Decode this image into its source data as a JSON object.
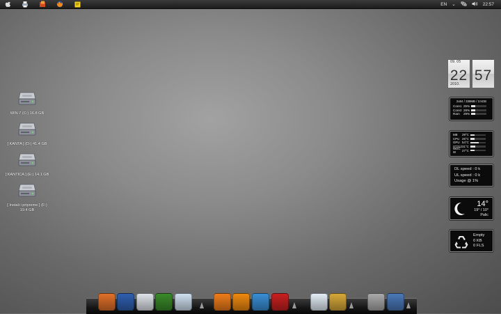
{
  "menubar": {
    "left_icons": [
      "apple-icon",
      "printer-icon",
      "office-icon",
      "firefox-icon",
      "sticky-note-icon"
    ],
    "lang": "EN",
    "time": "22:57"
  },
  "drives": [
    {
      "line1": "WIN 7 (C:) 16.8 GB",
      "line2": ""
    },
    {
      "line1": "[ KANTA ] (D:) 41.4 GB",
      "line2": ""
    },
    {
      "line1": "[ KANTICA ] (E:) 14.1 GB",
      "line2": ""
    },
    {
      "line1": "[ Instali i pripreme ] (F:)",
      "line2": "19.4 GB"
    }
  ],
  "clock": {
    "date": "09. 05",
    "year": "2010.",
    "hour": "22",
    "minute": "57"
  },
  "cpu_widget": {
    "header": "2x84 / 338MB / 3.5GB",
    "rows": [
      {
        "label": "Core1",
        "pct": "25%",
        "value": 0.25
      },
      {
        "label": "Core2",
        "pct": "28%",
        "value": 0.28
      },
      {
        "label": "Ram",
        "pct": "29%",
        "value": 0.29
      }
    ]
  },
  "temp_widget": {
    "rows": [
      {
        "label": "MB",
        "val": "29°C",
        "value": 0.29
      },
      {
        "label": "CPU",
        "val": "25°C",
        "value": 0.25
      },
      {
        "label": "GPU",
        "val": "54°C",
        "value": 0.54
      },
      {
        "label": "ST312",
        "val": "31°C",
        "value": 0.31
      },
      {
        "label": "WDC W",
        "val": "27°C",
        "value": 0.27
      }
    ]
  },
  "net_widget": {
    "dl": "DL speed : 0 k",
    "ul": "UL speed : 0 k",
    "usage": "Usage @ 1%"
  },
  "weather_widget": {
    "temp": "14°",
    "range": "19° / 10°",
    "city": "Palic"
  },
  "recycle_widget": {
    "state": "Empty",
    "size": "0 KB",
    "files": "0 FLS"
  },
  "dock": {
    "items": [
      {
        "name": "firefox",
        "color": "#e0702a"
      },
      {
        "name": "feather",
        "color": "#2f5fae"
      },
      {
        "name": "skype",
        "color": "#dfe4ea"
      },
      {
        "name": "gadget-green",
        "color": "#3a8a2a"
      },
      {
        "name": "messenger-bird",
        "color": "#cfe0f0"
      },
      {
        "name": "avast",
        "color": "#ef7d1a"
      },
      {
        "name": "gom-player",
        "color": "#f08a10"
      },
      {
        "name": "teamviewer",
        "color": "#3a8fd6"
      },
      {
        "name": "virtual-dj",
        "color": "#c82020"
      },
      {
        "name": "quill",
        "color": "#e4eef6"
      },
      {
        "name": "photo-flower",
        "color": "#d6a83a"
      },
      {
        "name": "stack-folder",
        "color": "#aaaaaa"
      },
      {
        "name": "preview",
        "color": "#4a78b8"
      }
    ]
  }
}
